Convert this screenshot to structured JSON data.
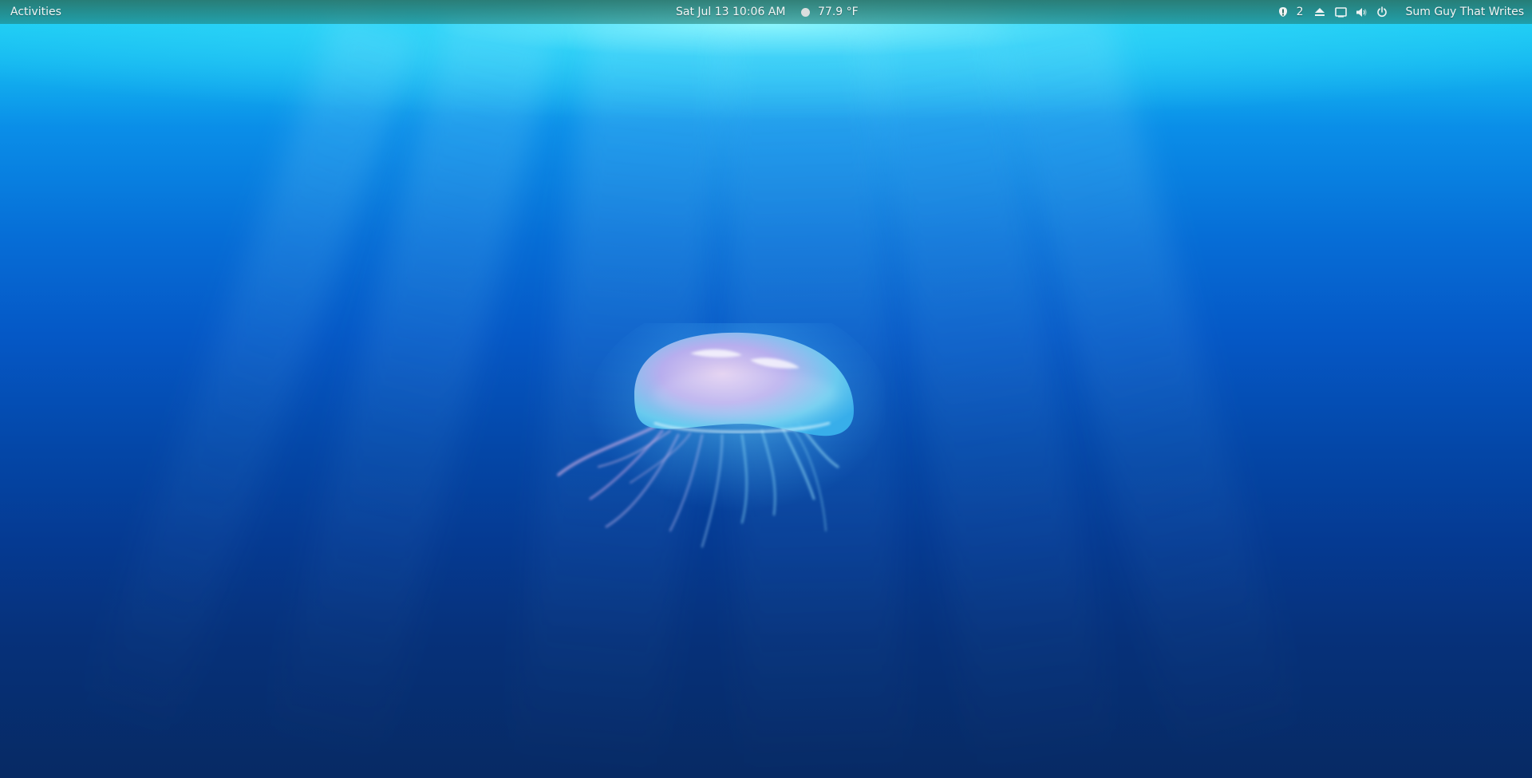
{
  "topbar": {
    "activities_label": "Activities",
    "clock": "Sat Jul 13  10:06 AM",
    "weather": {
      "icon": "weather-condition-dot-icon",
      "temperature": "77.9 °F"
    },
    "tray": {
      "notifications_icon": "notification-badge-icon",
      "notifications_count": "2",
      "icons": [
        "eject-icon",
        "display-icon",
        "volume-icon",
        "power-icon"
      ],
      "user_name": "Sum Guy That Writes"
    }
  },
  "wallpaper": {
    "subject": "jellyfish",
    "colors": {
      "surface": "#1fd8f6",
      "deep": "#072a64",
      "glow": "#a0ffff"
    }
  }
}
